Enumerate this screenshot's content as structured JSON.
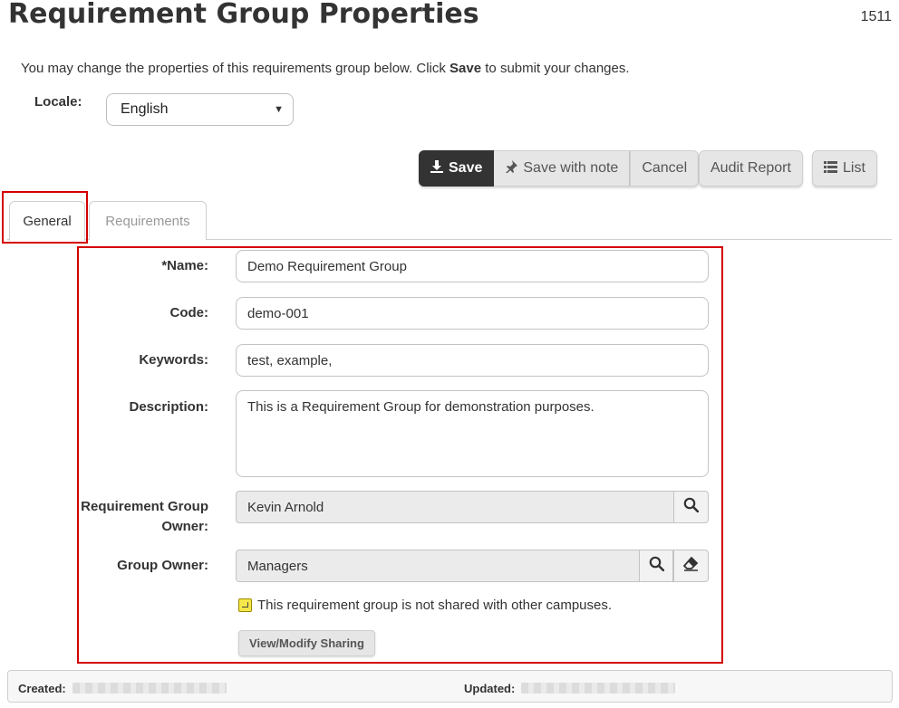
{
  "page": {
    "title": "Requirement Group Properties",
    "id_label": "1511"
  },
  "intro": {
    "prefix": "You may change the properties of this requirements group below. Click ",
    "bold": "Save",
    "suffix": " to submit your changes."
  },
  "locale": {
    "label": "Locale:",
    "value": "English"
  },
  "toolbar": {
    "save": "Save",
    "save_with_note": "Save with note",
    "cancel": "Cancel",
    "audit_report": "Audit Report",
    "list": "List"
  },
  "tabs": [
    {
      "label": "General",
      "active": true
    },
    {
      "label": "Requirements",
      "active": false
    }
  ],
  "form": {
    "name": {
      "label": "*Name:",
      "value": "Demo Requirement Group"
    },
    "code": {
      "label": "Code:",
      "value": "demo-001"
    },
    "keywords": {
      "label": "Keywords:",
      "value": "test, example,"
    },
    "description": {
      "label": "Description:",
      "value": "This is a Requirement Group for demonstration purposes."
    },
    "req_owner": {
      "label_line1": "Requirement Group",
      "label_line2": "Owner:",
      "value": "Kevin Arnold"
    },
    "group_owner": {
      "label": "Group Owner:",
      "value": "Managers"
    },
    "sharing_note": "This requirement group is not shared with other campuses.",
    "sharing_button": "View/Modify Sharing"
  },
  "footer": {
    "created_label": "Created:",
    "updated_label": "Updated:"
  },
  "colors": {
    "save_bg": "#333333",
    "highlight": "#d40000",
    "readonly_bg": "#ebebeb"
  }
}
